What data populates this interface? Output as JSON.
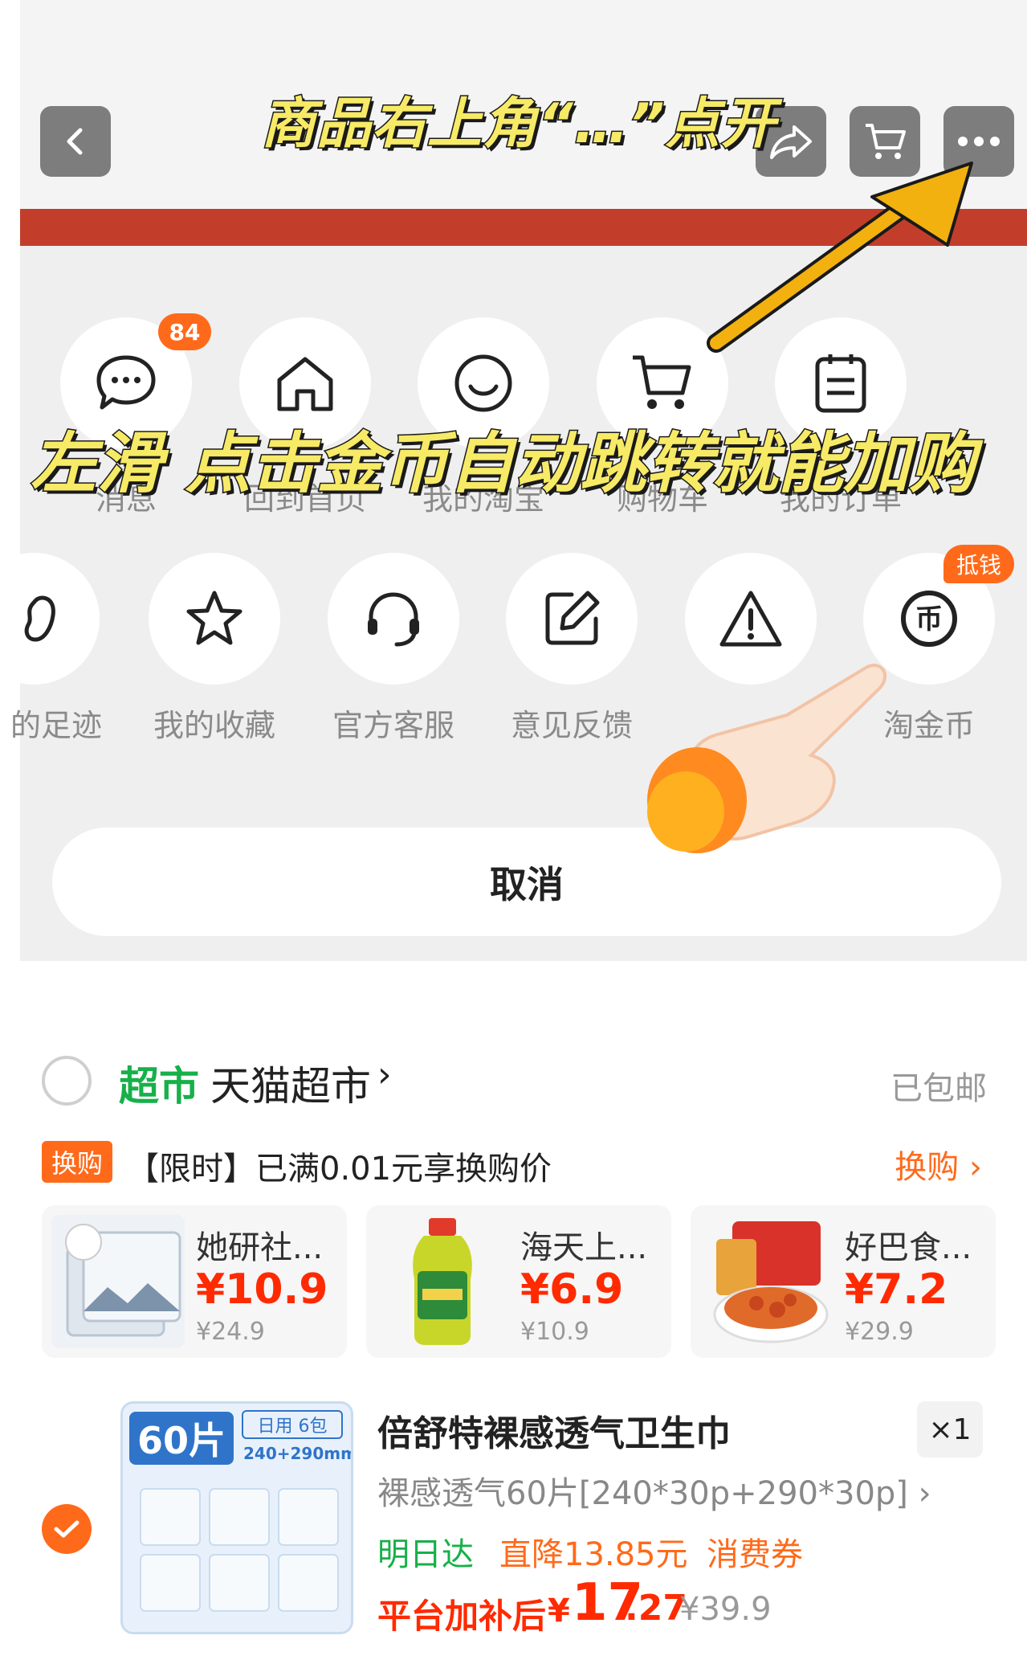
{
  "colors": {
    "accent": "#ff6a1a",
    "price": "#ff2a00",
    "green": "#17b04a",
    "caption": "#f7ea66",
    "brand_band": "#c23e2b"
  },
  "header": {
    "back_icon": "chevron-left-icon",
    "share_icon": "share-icon",
    "cart_icon": "cart-icon",
    "more_icon": "more-dots-icon"
  },
  "captions": {
    "top": "商品右上角“…”点开",
    "middle": "左滑 点击金币自动跳转就能加购"
  },
  "share_sheet": {
    "row1": [
      {
        "label": "消息",
        "icon": "message-icon",
        "badge": "84"
      },
      {
        "label": "回到首页",
        "icon": "home-icon"
      },
      {
        "label": "我的淘宝",
        "icon": "smile-icon"
      },
      {
        "label": "购物车",
        "icon": "cart-icon"
      },
      {
        "label": "我的订单",
        "icon": "order-icon"
      }
    ],
    "row2": [
      {
        "label": "的足迹",
        "icon": "footprint-icon"
      },
      {
        "label": "我的收藏",
        "icon": "star-icon"
      },
      {
        "label": "官方客服",
        "icon": "headset-icon"
      },
      {
        "label": "意见反馈",
        "icon": "edit-icon"
      },
      {
        "label": "",
        "icon": "warning-icon"
      },
      {
        "label": "淘金币",
        "icon": "coin-icon",
        "badge": "抵钱"
      }
    ],
    "cancel": "取消"
  },
  "cart": {
    "shop": {
      "tag": "超市",
      "name": "天猫超市",
      "arrow": "›",
      "shipping": "已包邮"
    },
    "swap": {
      "tag": "换购",
      "text": "【限时】已满0.01元享换购价",
      "link": "换购 ›",
      "items": [
        {
          "name": "她研社...",
          "price": "¥10.9",
          "orig": "¥24.9"
        },
        {
          "name": "海天上...",
          "price": "¥6.9",
          "orig": "¥10.9"
        },
        {
          "name": "好巴食...",
          "price": "¥7.2",
          "orig": "¥29.9"
        }
      ]
    },
    "item": {
      "image_badge": "60片",
      "image_tag": "日用 6包",
      "image_size": "240+290mm",
      "title": "倍舒特裸感透气卫生巾",
      "qty": "×1",
      "sku": "裸感透气60片[240*30p+290*30p] ›",
      "delivery": "明日达",
      "discount": "直降13.85元",
      "coupon": "消费券",
      "price_label": "平台加补后",
      "price_symbol": "¥",
      "price_int": "17",
      "price_dec": ".27",
      "orig_price": "¥39.9"
    }
  }
}
